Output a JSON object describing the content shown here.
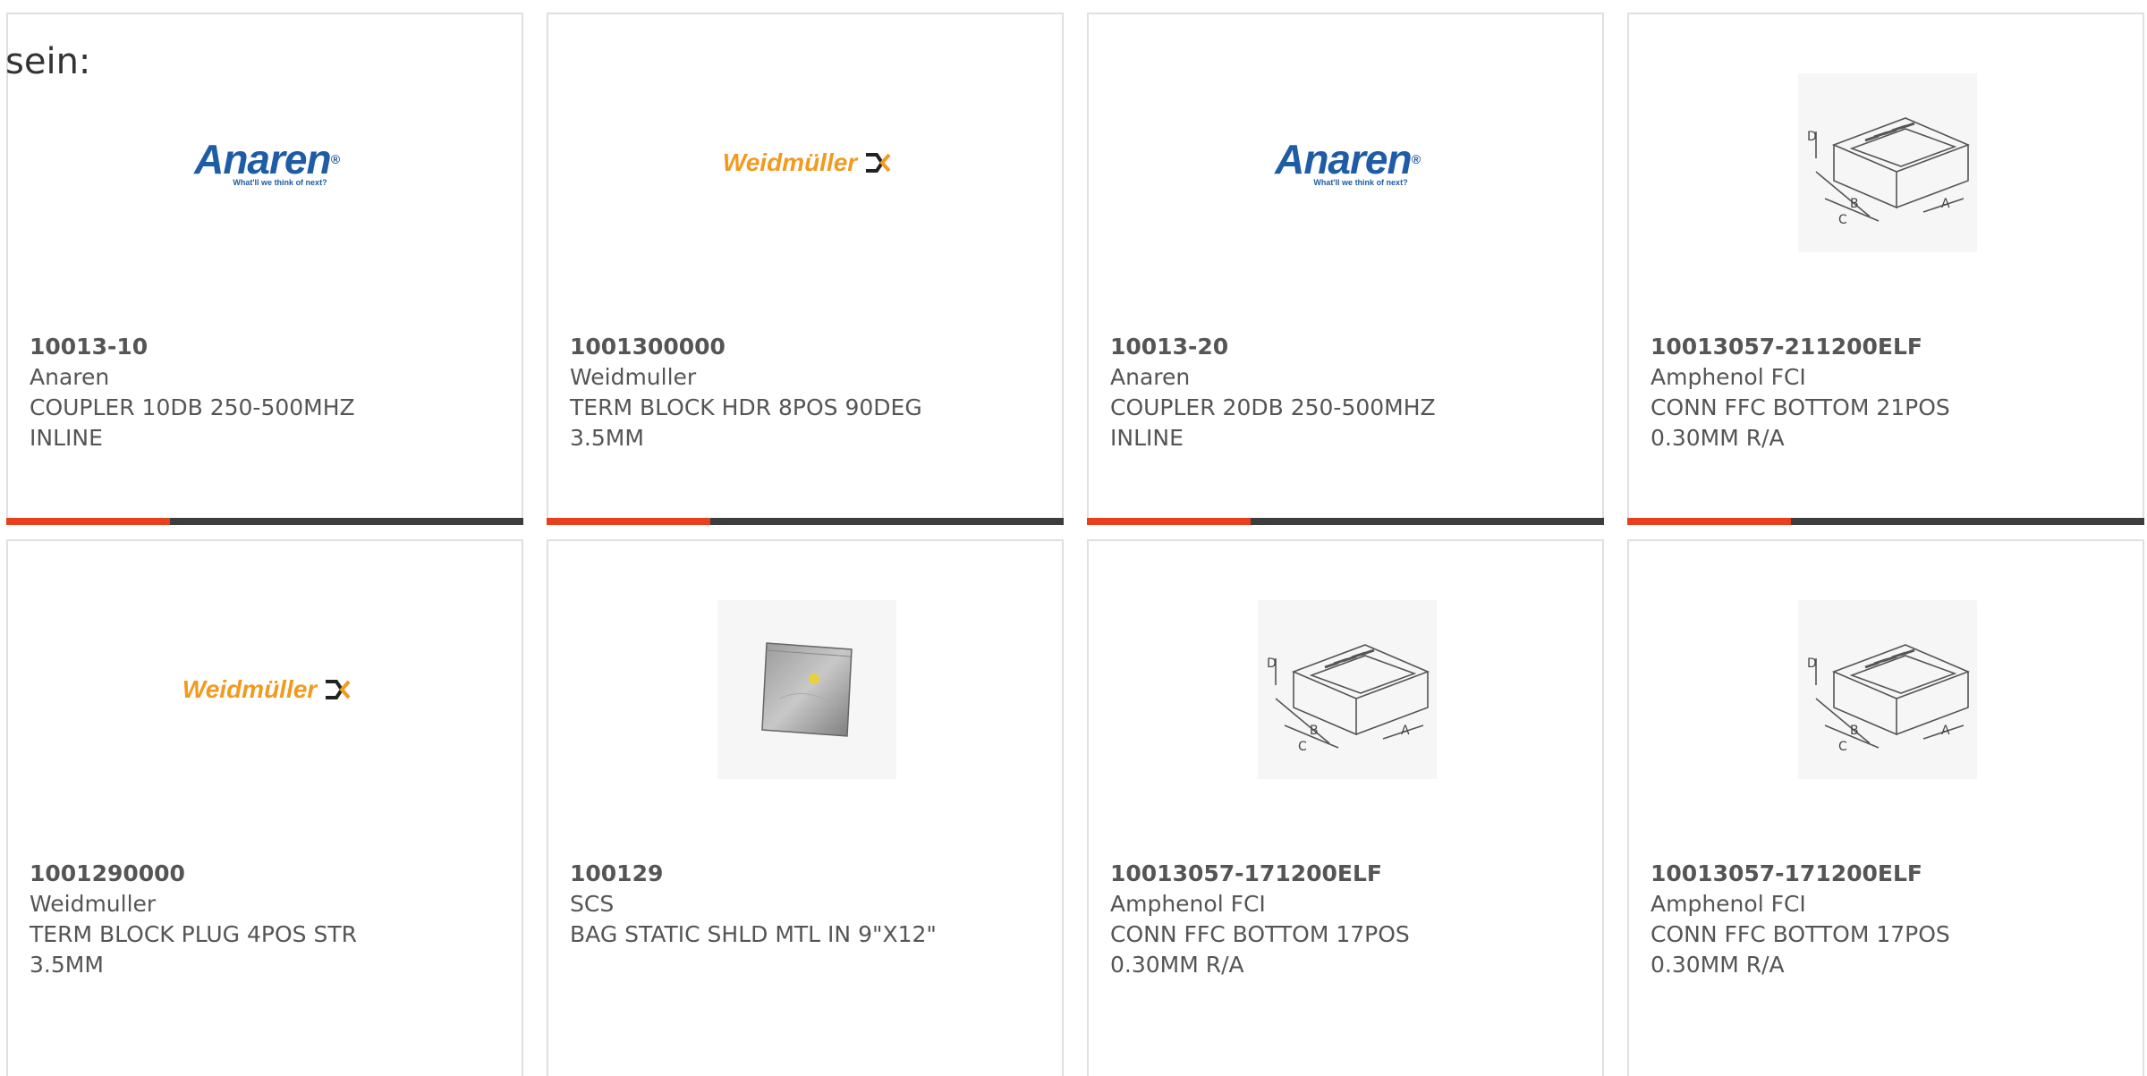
{
  "intro_text": "sein:",
  "products": [
    {
      "part": "10013-10",
      "maker": "Anaren",
      "desc1": "COUPLER 10DB 250-500MHZ",
      "desc2": "INLINE",
      "image": "anaren-logo",
      "logo_text": "Anaren",
      "logo_tagline": "What'll we think of next?"
    },
    {
      "part": "1001300000",
      "maker": "Weidmuller",
      "desc1": "TERM BLOCK HDR 8POS 90DEG",
      "desc2": "3.5MM",
      "image": "weidmuller-logo",
      "logo_text": "Weidmüller"
    },
    {
      "part": "10013-20",
      "maker": "Anaren",
      "desc1": "COUPLER 20DB 250-500MHZ",
      "desc2": "INLINE",
      "image": "anaren-logo",
      "logo_text": "Anaren",
      "logo_tagline": "What'll we think of next?"
    },
    {
      "part": "10013057-211200ELF",
      "maker": "Amphenol FCI",
      "desc1": "CONN FFC BOTTOM 21POS",
      "desc2": "0.30MM R/A",
      "image": "ffc-connector-drawing"
    },
    {
      "part": "1001290000",
      "maker": "Weidmuller",
      "desc1": "TERM BLOCK PLUG 4POS STR",
      "desc2": "3.5MM",
      "image": "weidmuller-logo",
      "logo_text": "Weidmüller"
    },
    {
      "part": "100129",
      "maker": "SCS",
      "desc1": "BAG STATIC SHLD MTL IN 9\"X12\"",
      "desc2": "",
      "image": "static-bag-photo"
    },
    {
      "part": "10013057-171200ELF",
      "maker": "Amphenol FCI",
      "desc1": "CONN FFC BOTTOM 17POS",
      "desc2": "0.30MM R/A",
      "image": "ffc-connector-drawing"
    },
    {
      "part": "10013057-171200ELF",
      "maker": "Amphenol FCI",
      "desc1": "CONN FFC BOTTOM 17POS",
      "desc2": "0.30MM R/A",
      "image": "ffc-connector-drawing"
    }
  ],
  "colors": {
    "accent": "#e8401c",
    "bar_dark": "#3d3d3d",
    "anaren_blue": "#1f5ca6",
    "weidmuller_orange": "#f29a1e"
  }
}
